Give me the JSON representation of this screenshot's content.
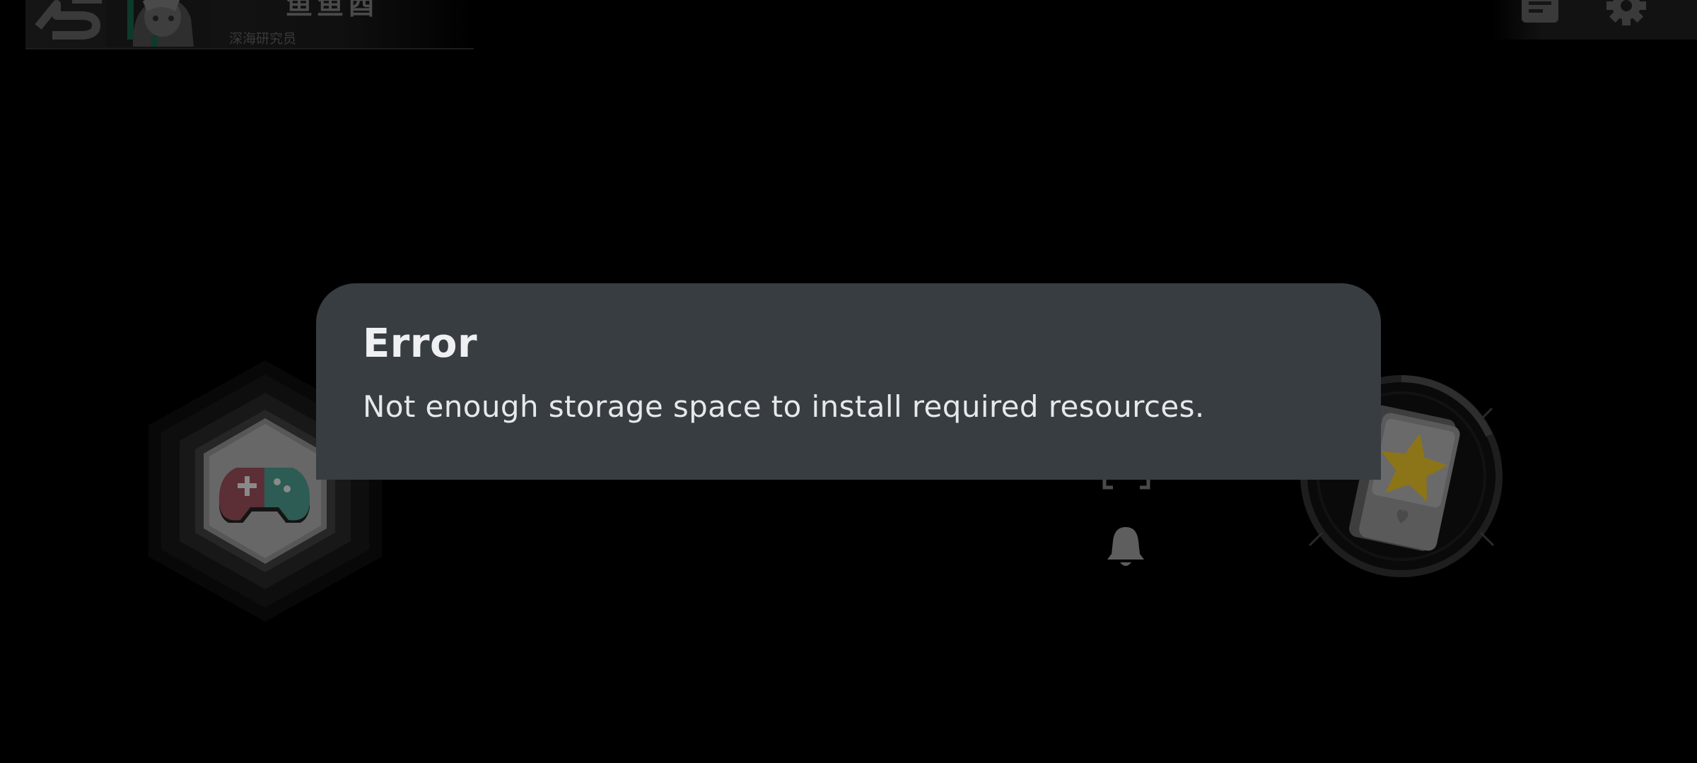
{
  "profile": {
    "name": "鱼鱼酉",
    "title": "深海研究员"
  },
  "dialog": {
    "title": "Error",
    "message": "Not enough storage space to install required resources."
  },
  "icons": {
    "back": "back-arrow-icon",
    "avatar": "character-avatar",
    "document": "document-icon",
    "settings": "gear-icon",
    "game": "gamepad-icon",
    "cards": "star-card-icon",
    "scan": "scan-frame-icon",
    "notification": "bell-icon"
  },
  "colors": {
    "dialog_background": "#383d42",
    "dialog_text": "#eef0f2",
    "backdrop": "#000000",
    "gamepad_red": "#5c2e36",
    "gamepad_green": "#2c5c54",
    "star": "#8c7418"
  }
}
